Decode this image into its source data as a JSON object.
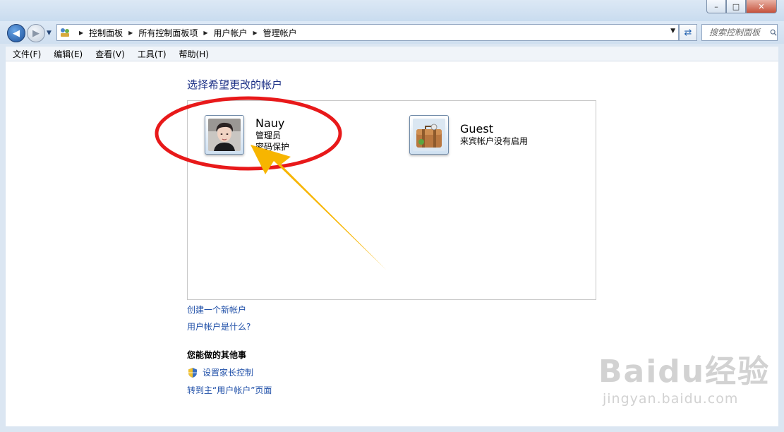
{
  "window": {
    "minimize_label": "–",
    "maximize_label": "□",
    "close_label": "✕"
  },
  "nav": {
    "breadcrumbs": [
      "控制面板",
      "所有控制面板项",
      "用户帐户",
      "管理帐户"
    ],
    "search_placeholder": "搜索控制面板"
  },
  "menu": {
    "items": [
      "文件(F)",
      "编辑(E)",
      "查看(V)",
      "工具(T)",
      "帮助(H)"
    ]
  },
  "main": {
    "heading": "选择希望更改的帐户",
    "accounts": [
      {
        "name": "Nauy",
        "details": [
          "管理员",
          "密码保护"
        ]
      },
      {
        "name": "Guest",
        "details": [
          "来宾帐户没有启用"
        ]
      }
    ],
    "links": [
      "创建一个新帐户",
      "用户帐户是什么?"
    ],
    "other_heading": "您能做的其他事",
    "tasks": [
      "设置家长控制",
      "转到主“用户帐户”页面"
    ]
  },
  "watermark": {
    "brand": "Baidu经验",
    "url": "jingyan.baidu.com"
  },
  "colors": {
    "heading": "#1e3287",
    "link": "#1f4fa8",
    "annotation_circle": "#e8191a",
    "annotation_arrow": "#f7b500"
  }
}
